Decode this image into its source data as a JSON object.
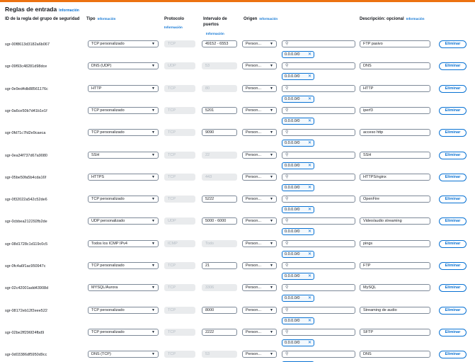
{
  "section": {
    "title": "Reglas de entrada",
    "info_label": "Información"
  },
  "headers": {
    "rule_id": "ID de la regla del grupo de seguridad",
    "type": "Tipo",
    "protocol": "Protocolo",
    "port_range": "Intervalo de puertos",
    "source": "Origen",
    "description": "Descripción: opcional",
    "info": "Información"
  },
  "search_icon": "search-icon",
  "delete_label": "Eliminar",
  "token_value": "0.0.0.0/0",
  "token_remove": "✕",
  "rules": [
    {
      "id": "sgr-00f8613d3182a6b067",
      "type": "TCP personalizado",
      "protocol": "TCP",
      "ports": "49152 - 6553",
      "ports_editable": true,
      "source": "Person...",
      "description": "FTP pasivo"
    },
    {
      "id": "sgr-09f93c48281d98dce",
      "type": "DNS (UDP)",
      "protocol": "UDP",
      "ports": "53",
      "ports_editable": false,
      "source": "Person...",
      "description": "DNS"
    },
    {
      "id": "sgr-0e9ed4db88561176c",
      "type": "HTTP",
      "protocol": "TCP",
      "ports": "80",
      "ports_editable": false,
      "source": "Person...",
      "description": "HTTP"
    },
    {
      "id": "sgr-0a6ce50b7d41b1e1f",
      "type": "TCP personalizado",
      "protocol": "TCP",
      "ports": "5201",
      "ports_editable": true,
      "source": "Person...",
      "description": "iperf3"
    },
    {
      "id": "sgr-0fd71c7fd2e9caeca",
      "type": "TCP personalizado",
      "protocol": "TCP",
      "ports": "9090",
      "ports_editable": true,
      "source": "Person...",
      "description": "acceso http"
    },
    {
      "id": "sgr-0ea34f737d67a9080",
      "type": "SSH",
      "protocol": "TCP",
      "ports": "22",
      "ports_editable": false,
      "source": "Person...",
      "description": "SSH"
    },
    {
      "id": "sgr-05be50fa5b4cda16f",
      "type": "HTTPS",
      "protocol": "TCP",
      "ports": "443",
      "ports_editable": false,
      "source": "Person...",
      "description": "HTTPS/nginx"
    },
    {
      "id": "sgr-0f32022a542c52de6",
      "type": "TCP personalizado",
      "protocol": "TCP",
      "ports": "5222",
      "ports_editable": true,
      "source": "Person...",
      "description": "OpenFire"
    },
    {
      "id": "sgr-0cbbea212292fb2de",
      "type": "UDP personalizado",
      "protocol": "UDP",
      "ports": "5000 - 6000",
      "ports_editable": true,
      "source": "Person...",
      "description": "Video/audio streaming"
    },
    {
      "id": "sgr-08d1728c1d119c0c5",
      "type": "Todos los ICMP IPv4",
      "protocol": "ICMP",
      "ports": "Todo",
      "ports_editable": false,
      "source": "Person...",
      "description": "pings"
    },
    {
      "id": "sgr-0fc4a6f1ac950947c",
      "type": "TCP personalizado",
      "protocol": "TCP",
      "ports": "21",
      "ports_editable": true,
      "source": "Person...",
      "description": "FTP"
    },
    {
      "id": "sgr-02c42001add43908d",
      "type": "MYSQL/Aurora",
      "protocol": "TCP",
      "ports": "3306",
      "ports_editable": false,
      "source": "Person...",
      "description": "MySQL"
    },
    {
      "id": "sgr-08172eb12f2eee522",
      "type": "TCP personalizado",
      "protocol": "TCP",
      "ports": "8000",
      "ports_editable": true,
      "source": "Person...",
      "description": "Streaming de audio"
    },
    {
      "id": "sgr-02be2ff296f24fbd9",
      "type": "TCP personalizado",
      "protocol": "TCP",
      "ports": "2222",
      "ports_editable": true,
      "source": "Person...",
      "description": "SFTP"
    },
    {
      "id": "sgr-0d03386df5950d9cc",
      "type": "DNS (TCP)",
      "protocol": "TCP",
      "ports": "53",
      "ports_editable": false,
      "source": "Person...",
      "description": "DNS"
    }
  ]
}
